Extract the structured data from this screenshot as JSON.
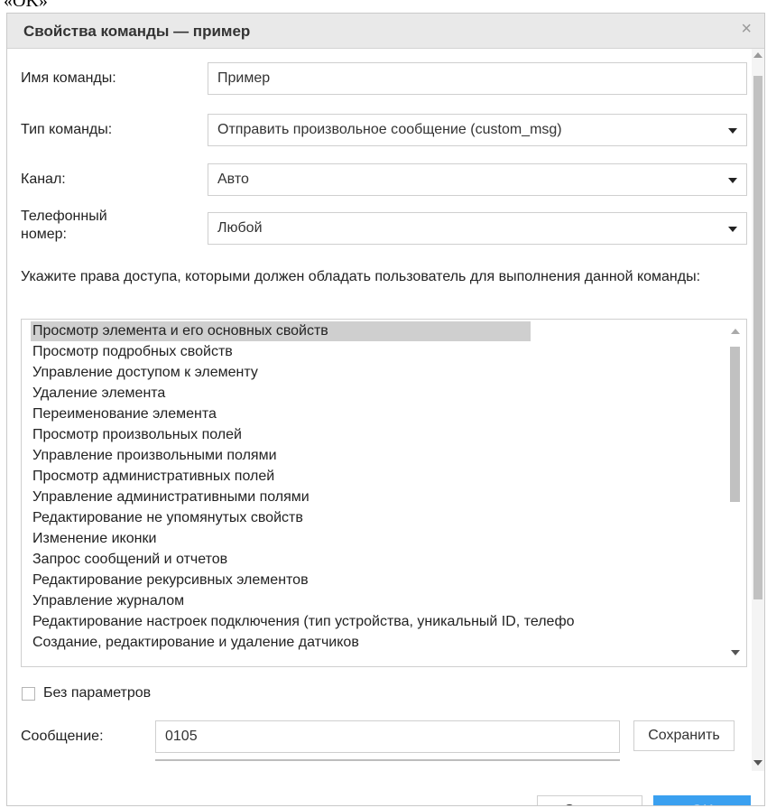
{
  "background": {
    "clipped_text": "«OK»"
  },
  "dialog": {
    "title": "Свойства команды — пример",
    "close_glyph": "×"
  },
  "form": {
    "name_label": "Имя команды:",
    "name_value": "Пример",
    "type_label": "Тип команды:",
    "type_value": "Отправить произвольное сообщение (custom_msg)",
    "channel_label": "Канал:",
    "channel_value": "Авто",
    "phone_label_line1": "Телефонный",
    "phone_label_line2": "номер:",
    "phone_value": "Любой",
    "permissions_hint": "Укажите права доступа, которыми должен обладать пользователь для выполнения данной команды:"
  },
  "permissions": [
    "Просмотр элемента и его основных свойств",
    "Просмотр подробных свойств",
    "Управление доступом к элементу",
    "Удаление элемента",
    "Переименование элемента",
    "Просмотр произвольных полей",
    "Управление произвольными полями",
    "Просмотр административных полей",
    "Управление административными полями",
    "Редактирование не упомянутых свойств",
    "Изменение иконки",
    "Запрос сообщений и отчетов",
    "Редактирование рекурсивных элементов",
    "Управление журналом",
    "Редактирование настроек подключения (тип устройства, уникальный ID, телефо",
    "Создание, редактирование и удаление датчиков"
  ],
  "no_params": {
    "label": "Без параметров",
    "checked": false
  },
  "message": {
    "label": "Сообщение:",
    "value": "0105",
    "save_label": "Сохранить"
  },
  "buttons": {
    "cancel_label": "Отмена",
    "ok_label": "OK"
  },
  "colors": {
    "accent": "#3aa0f0",
    "titlebar": "#e9e9e9",
    "selected_row": "#cfcfcf"
  }
}
